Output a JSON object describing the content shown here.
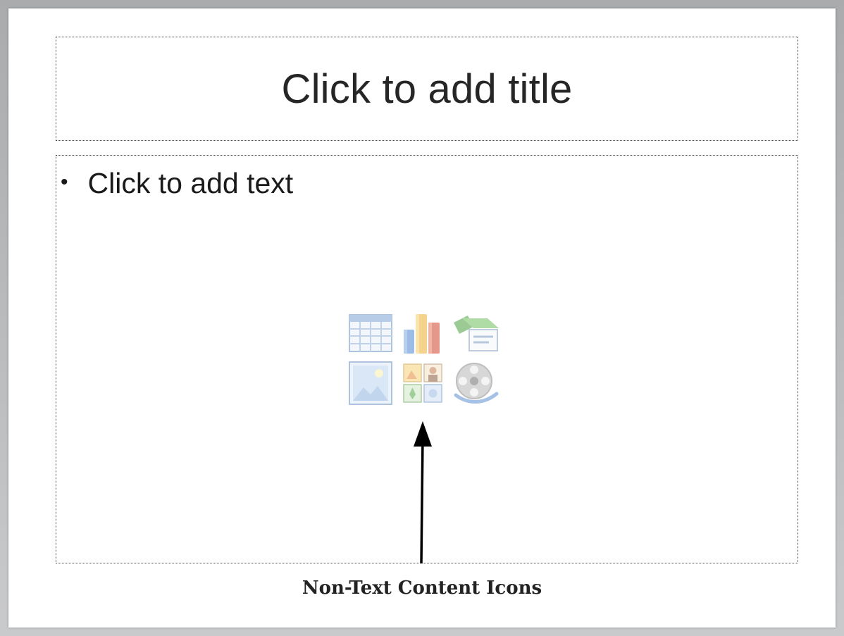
{
  "slide": {
    "title_placeholder": "Click to add title",
    "body_placeholder": "Click to add text",
    "bullet": "•"
  },
  "content_icons": [
    {
      "icon": "insert-table-icon"
    },
    {
      "icon": "insert-chart-icon"
    },
    {
      "icon": "insert-smartart-icon"
    },
    {
      "icon": "insert-picture-icon"
    },
    {
      "icon": "insert-clip-art-icon"
    },
    {
      "icon": "insert-media-clip-icon"
    }
  ],
  "annotation": {
    "caption": "Non-Text Content Icons"
  },
  "colors": {
    "placeholder_border": "#4b4b4b",
    "slide_background": "#ffffff",
    "frame": "#b9babb"
  }
}
